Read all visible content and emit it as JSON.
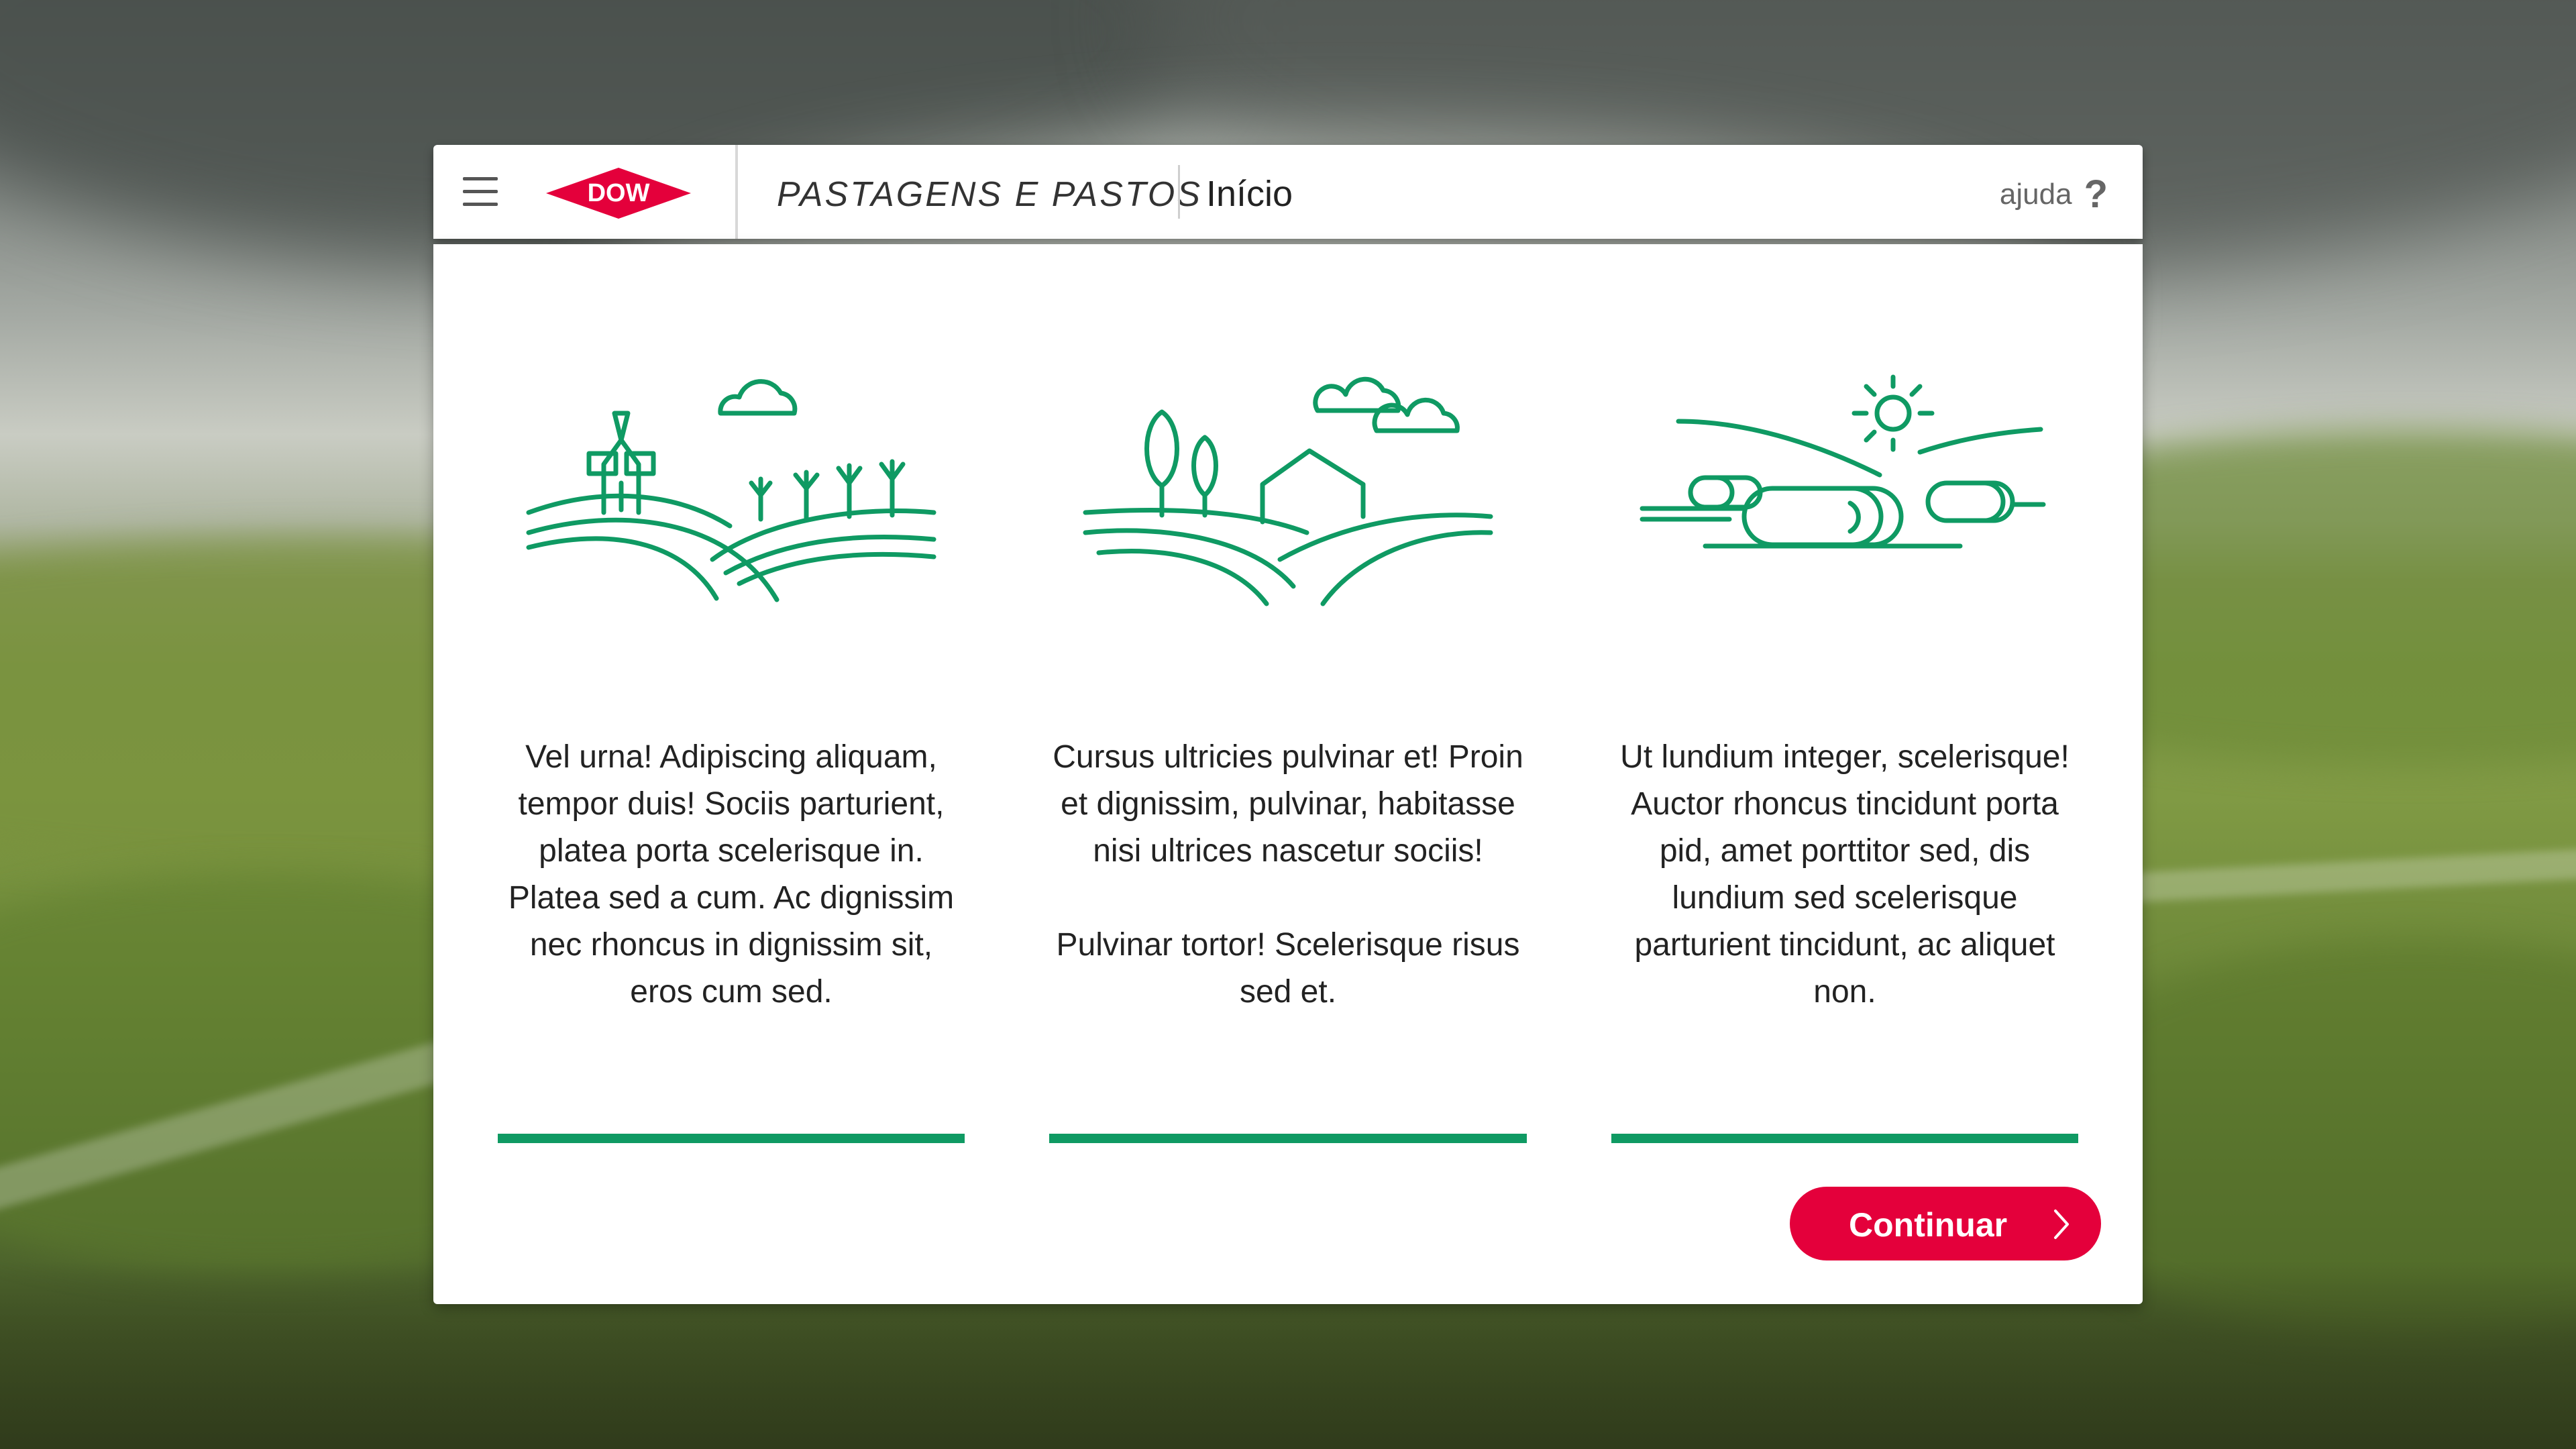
{
  "header": {
    "menu_icon": "hamburger-menu-icon",
    "logo_text": "DOW",
    "app_title": "PASTAGENS E PASTOS",
    "page_title": "Início",
    "help_label": "ajuda",
    "help_icon": "?"
  },
  "columns": [
    {
      "illustration": "farm-windmill-crops-icon",
      "paragraphs": [
        "Vel urna! Adipiscing aliquam, tempor duis! Sociis parturient, platea porta scelerisque in. Platea sed a cum. Ac dignissim nec rhoncus in dignissim sit, eros cum sed."
      ]
    },
    {
      "illustration": "hills-trees-barn-icon",
      "paragraphs": [
        "Cursus ultricies pulvinar et! Proin et dignissim, pulvinar, habitasse nisi ultrices nascetur sociis!",
        "Pulvinar tortor! Scelerisque risus sed et."
      ]
    },
    {
      "illustration": "hay-bales-sun-icon",
      "paragraphs": [
        "Ut lundium integer, scelerisque! Auctor rhoncus tincidunt porta pid, amet porttitor sed, dis lundium sed scelerisque parturient tincidunt, ac aliquet non."
      ]
    }
  ],
  "footer": {
    "continue_label": "Continuar",
    "continue_icon": "chevron-right-icon"
  },
  "colors": {
    "accent_green": "#0f9a63",
    "brand_red": "#e4003b",
    "header_bg": "#ffffff"
  }
}
